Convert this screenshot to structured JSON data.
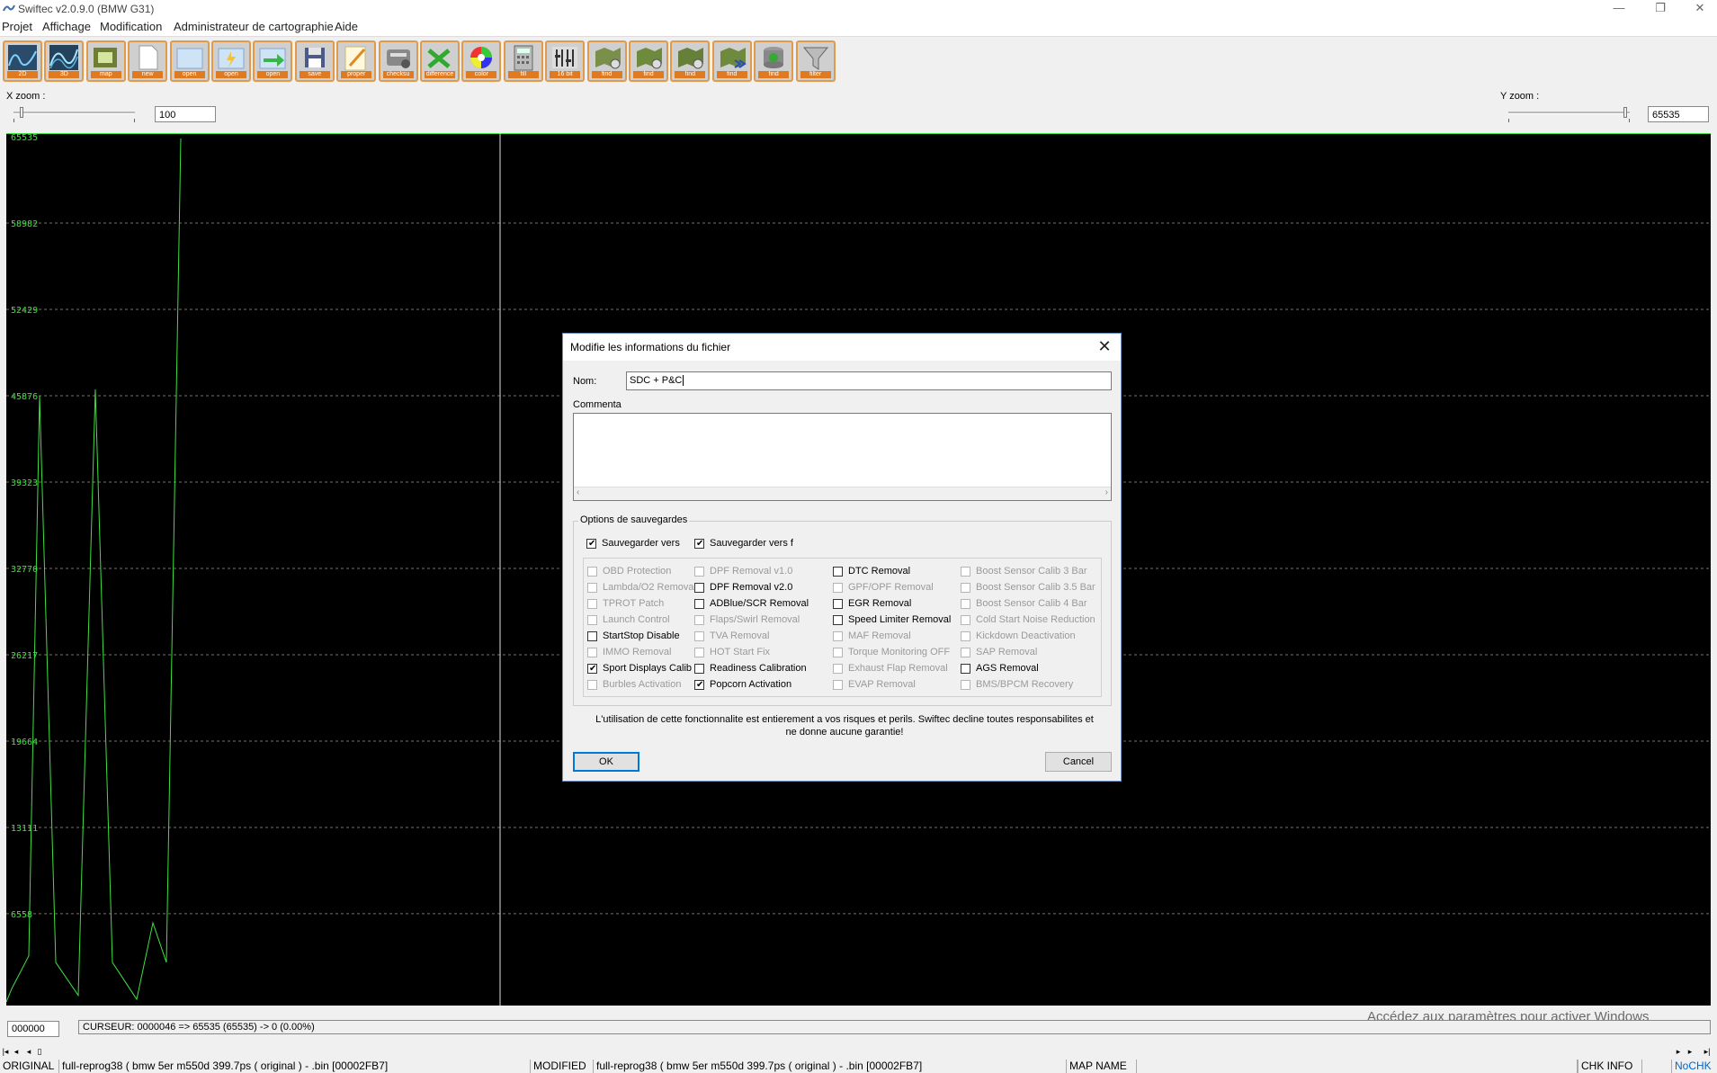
{
  "window": {
    "title": "Swiftec v2.0.9.0 (BMW G31)",
    "controls": {
      "minimize": "—",
      "restore": "❐",
      "close": "✕"
    }
  },
  "menu": [
    "Projet",
    "Affichage",
    "Modification",
    "Administrateur de cartographie",
    "Aide"
  ],
  "toolbar": {
    "buttons": [
      {
        "label": "2D",
        "icon": "2d-graph-icon"
      },
      {
        "label": "3D",
        "icon": "3d-graph-icon"
      },
      {
        "label": "map",
        "icon": "map-icon"
      },
      {
        "label": "new",
        "icon": "new-file-icon"
      },
      {
        "label": "open",
        "icon": "open-file-icon"
      },
      {
        "label": "open",
        "icon": "open-flash-icon"
      },
      {
        "label": "open",
        "icon": "open-arrow-icon"
      },
      {
        "label": "save",
        "icon": "save-icon"
      },
      {
        "label": "proper",
        "icon": "properties-icon"
      },
      {
        "label": "checksu",
        "icon": "checksum-icon"
      },
      {
        "label": "difference",
        "icon": "difference-icon"
      },
      {
        "label": "color",
        "icon": "color-wheel-icon"
      },
      {
        "label": "fill",
        "icon": "calculator-icon"
      },
      {
        "label": "16 bit",
        "icon": "16bit-icon"
      },
      {
        "label": "find",
        "icon": "find-map-icon"
      },
      {
        "label": "find",
        "icon": "find-map-2-icon"
      },
      {
        "label": "find",
        "icon": "find-map-3-icon"
      },
      {
        "label": "find",
        "icon": "find-next-icon"
      },
      {
        "label": "find",
        "icon": "find-db-icon"
      },
      {
        "label": "filter",
        "icon": "filter-icon"
      }
    ]
  },
  "zoom": {
    "x_label": "X zoom :",
    "x_value": "100",
    "x_level": 0.05,
    "y_label": "Y zoom :",
    "y_value": "65535",
    "y_level": 0.98
  },
  "graph": {
    "y_ticks": [
      "65535",
      "58982",
      "52429",
      "45876",
      "39323",
      "32770",
      "26217",
      "19664",
      "13111",
      "6558"
    ],
    "y_values": [
      65535,
      58982,
      52429,
      45876,
      39323,
      32770,
      26217,
      19664,
      13111,
      6558
    ],
    "trace": [
      [
        0,
        0
      ],
      [
        6,
        1000
      ],
      [
        25,
        3500
      ],
      [
        37,
        46000
      ],
      [
        55,
        3000
      ],
      [
        80,
        500
      ],
      [
        99,
        46500
      ],
      [
        118,
        3000
      ],
      [
        145,
        200
      ],
      [
        163,
        6000
      ],
      [
        178,
        3000
      ],
      [
        194,
        65535
      ]
    ],
    "trace_color": "#3fe03f",
    "cursor_x": 549
  },
  "watermark": "Accédez aux paramètres pour activer Windows",
  "cursor_row": {
    "address": "000000",
    "info": "CURSEUR: 0000046 => 65535 (65535) -> 0 (0.00%)"
  },
  "scroll": {
    "first": "|◂",
    "prev": "◂",
    "next": "▸",
    "last": "▸|"
  },
  "statusbar": {
    "original_label": "ORIGINAL",
    "original_file": "full-reprog38 ( bmw 5er m550d 399.7ps ( original ) - .bin [00002FB7]",
    "modified_label": "MODIFIED",
    "modified_file": "full-reprog38 ( bmw 5er m550d 399.7ps ( original ) - .bin [00002FB7]",
    "map_name_label": "MAP NAME",
    "map_name_value": "",
    "chk_info": "CHK INFO",
    "nochk": "NoCHK"
  },
  "dialog": {
    "title": "Modifie les informations du fichier",
    "close": "✕",
    "name_label": "Nom:",
    "name_value": "SDC + P&C",
    "comment_label": "Commenta",
    "comment_value": "",
    "options_title": "Options de sauvegardes",
    "save_to_1": "Sauvegarder vers",
    "save_to_2": "Sauvegarder vers f",
    "checkboxes": [
      [
        {
          "label": "OBD Protection",
          "checked": false,
          "enabled": false
        },
        {
          "label": "Lambda/O2 Remova",
          "checked": false,
          "enabled": false
        },
        {
          "label": "TPROT Patch",
          "checked": false,
          "enabled": false
        },
        {
          "label": "Launch Control",
          "checked": false,
          "enabled": false
        },
        {
          "label": "StartStop Disable",
          "checked": false,
          "enabled": true
        },
        {
          "label": "IMMO Removal",
          "checked": false,
          "enabled": false
        },
        {
          "label": "Sport Displays Calib",
          "checked": true,
          "enabled": true
        },
        {
          "label": "Burbles Activation",
          "checked": false,
          "enabled": false
        }
      ],
      [
        {
          "label": "DPF Removal v1.0",
          "checked": false,
          "enabled": false
        },
        {
          "label": "DPF Removal v2.0",
          "checked": false,
          "enabled": true
        },
        {
          "label": "ADBlue/SCR Removal",
          "checked": false,
          "enabled": true
        },
        {
          "label": "Flaps/Swirl Removal",
          "checked": false,
          "enabled": false
        },
        {
          "label": "TVA Removal",
          "checked": false,
          "enabled": false
        },
        {
          "label": "HOT Start Fix",
          "checked": false,
          "enabled": false
        },
        {
          "label": "Readiness Calibration",
          "checked": false,
          "enabled": true
        },
        {
          "label": "Popcorn Activation",
          "checked": true,
          "enabled": true
        }
      ],
      [
        {
          "label": "DTC Removal",
          "checked": false,
          "enabled": true
        },
        {
          "label": "GPF/OPF Removal",
          "checked": false,
          "enabled": false
        },
        {
          "label": "EGR Removal",
          "checked": false,
          "enabled": true
        },
        {
          "label": "Speed Limiter Removal",
          "checked": false,
          "enabled": true
        },
        {
          "label": "MAF Removal",
          "checked": false,
          "enabled": false
        },
        {
          "label": "Torque Monitoring OFF",
          "checked": false,
          "enabled": false
        },
        {
          "label": "Exhaust Flap Removal",
          "checked": false,
          "enabled": false
        },
        {
          "label": "EVAP Removal",
          "checked": false,
          "enabled": false
        }
      ],
      [
        {
          "label": "Boost Sensor Calib 3 Bar",
          "checked": false,
          "enabled": false
        },
        {
          "label": "Boost Sensor Calib 3.5 Bar",
          "checked": false,
          "enabled": false
        },
        {
          "label": "Boost Sensor Calib 4 Bar",
          "checked": false,
          "enabled": false
        },
        {
          "label": "Cold Start Noise Reduction",
          "checked": false,
          "enabled": false
        },
        {
          "label": "Kickdown Deactivation",
          "checked": false,
          "enabled": false
        },
        {
          "label": "SAP Removal",
          "checked": false,
          "enabled": false
        },
        {
          "label": "AGS Removal",
          "checked": false,
          "enabled": true
        },
        {
          "label": "BMS/BPCM Recovery",
          "checked": false,
          "enabled": false
        }
      ]
    ],
    "disclaimer_line1": "L'utilisation de cette fonctionnalite est entierement a vos risques et perils. Swiftec decline toutes responsabilites et",
    "disclaimer_line2": "ne donne aucune garantie!",
    "ok_label": "OK",
    "cancel_label": "Cancel"
  }
}
